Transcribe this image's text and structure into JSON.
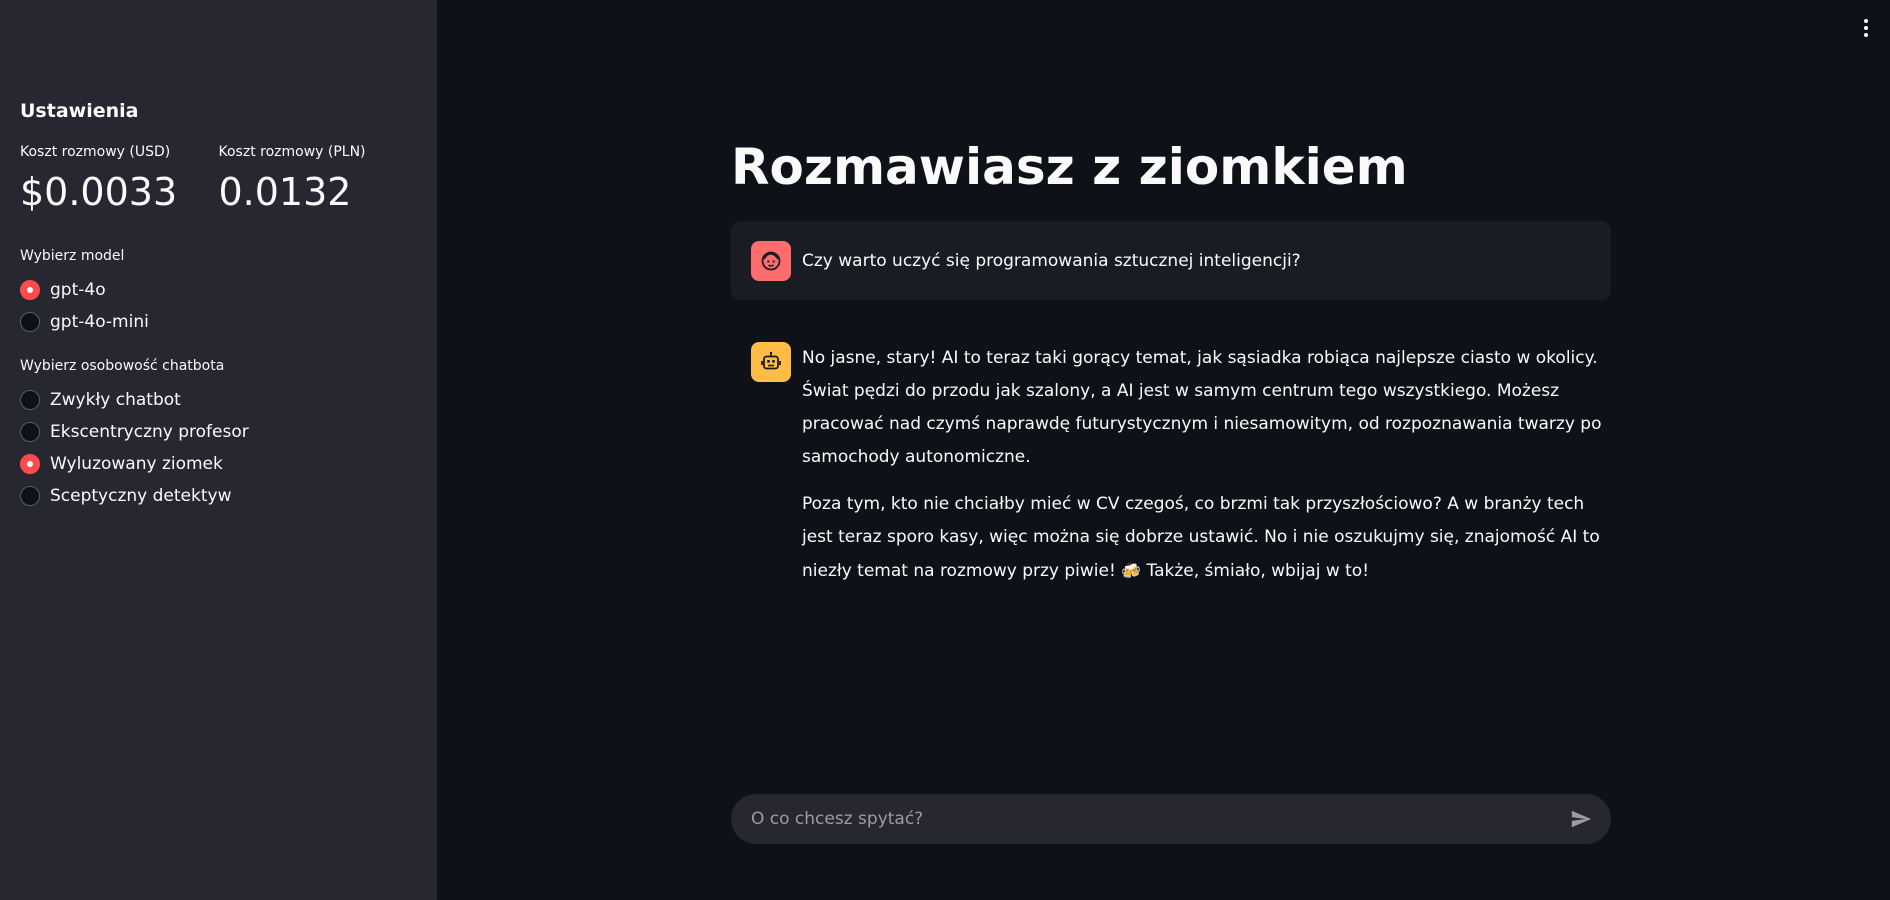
{
  "sidebar": {
    "title": "Ustawienia",
    "metrics": [
      {
        "label": "Koszt rozmowy (USD)",
        "value": "$0.0033"
      },
      {
        "label": "Koszt rozmowy (PLN)",
        "value": "0.0132"
      }
    ],
    "model_label": "Wybierz model",
    "models": [
      {
        "label": "gpt-4o",
        "selected": true
      },
      {
        "label": "gpt-4o-mini",
        "selected": false
      }
    ],
    "personality_label": "Wybierz osobowość chatbota",
    "personalities": [
      {
        "label": "Zwykły chatbot",
        "selected": false
      },
      {
        "label": "Ekscentryczny profesor",
        "selected": false
      },
      {
        "label": "Wyluzowany ziomek",
        "selected": true
      },
      {
        "label": "Sceptyczny detektyw",
        "selected": false
      }
    ]
  },
  "main": {
    "title": "Rozmawiasz z ziomkiem",
    "user_message": "Czy warto uczyć się programowania sztucznej inteligencji?",
    "bot_message": {
      "paragraph1": "No jasne, stary! AI to teraz taki gorący temat, jak sąsiadka robiąca najlepsze ciasto w okolicy. Świat pędzi do przodu jak szalony, a AI jest w samym centrum tego wszystkiego. Możesz pracować nad czymś naprawdę futurystycznym i niesamowitym, od rozpoznawania twarzy po samochody autonomiczne.",
      "paragraph2_before": "Poza tym, kto nie chciałby mieć w CV czegoś, co brzmi tak przyszłościowo? A w branży tech jest teraz sporo kasy, więc można się dobrze ustawić. No i nie oszukujmy się, znajomość AI to niezły temat na rozmowy przy piwie!",
      "emoji": "🍻",
      "paragraph2_after": "Także, śmiało, wbijaj w to!"
    },
    "input": {
      "placeholder": "O co chcesz spytać?",
      "value": ""
    }
  },
  "icons": {
    "user_avatar": "face-icon",
    "bot_avatar": "robot-icon",
    "menu": "kebab-menu-icon",
    "send": "send-icon"
  },
  "colors": {
    "accent": "#ff4b4b",
    "user_avatar_bg": "#ff6c6c",
    "bot_avatar_bg": "#ffbd45",
    "sidebar_bg": "#262730",
    "main_bg": "#0e1117"
  }
}
